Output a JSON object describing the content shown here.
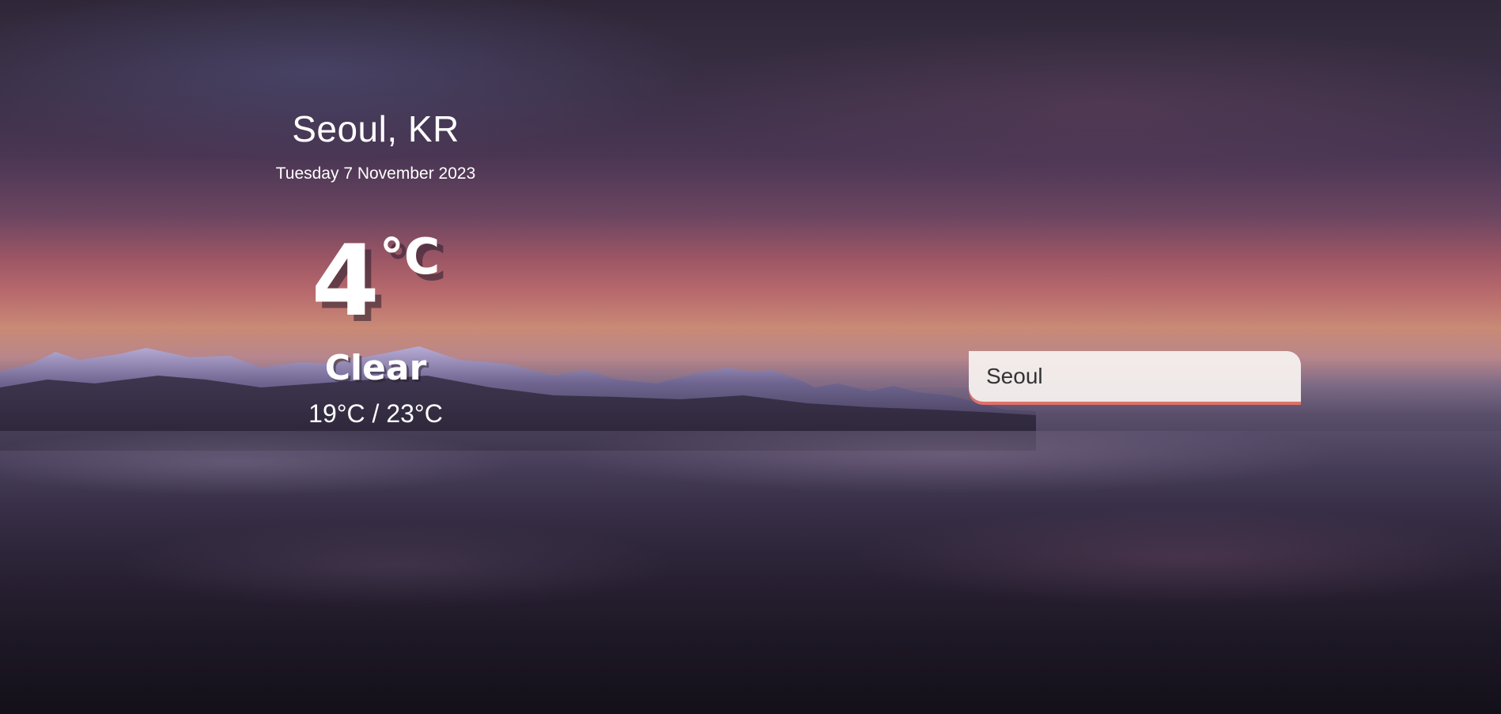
{
  "weather": {
    "location": "Seoul, KR",
    "date": "Tuesday 7 November 2023",
    "temperature": "4",
    "unit": "°C",
    "condition": "Clear",
    "range": "19°C / 23°C"
  },
  "search": {
    "value": "Seoul"
  },
  "colors": {
    "accent": "#e07068",
    "text": "#ffffff",
    "input_bg": "#f5f0ee"
  }
}
